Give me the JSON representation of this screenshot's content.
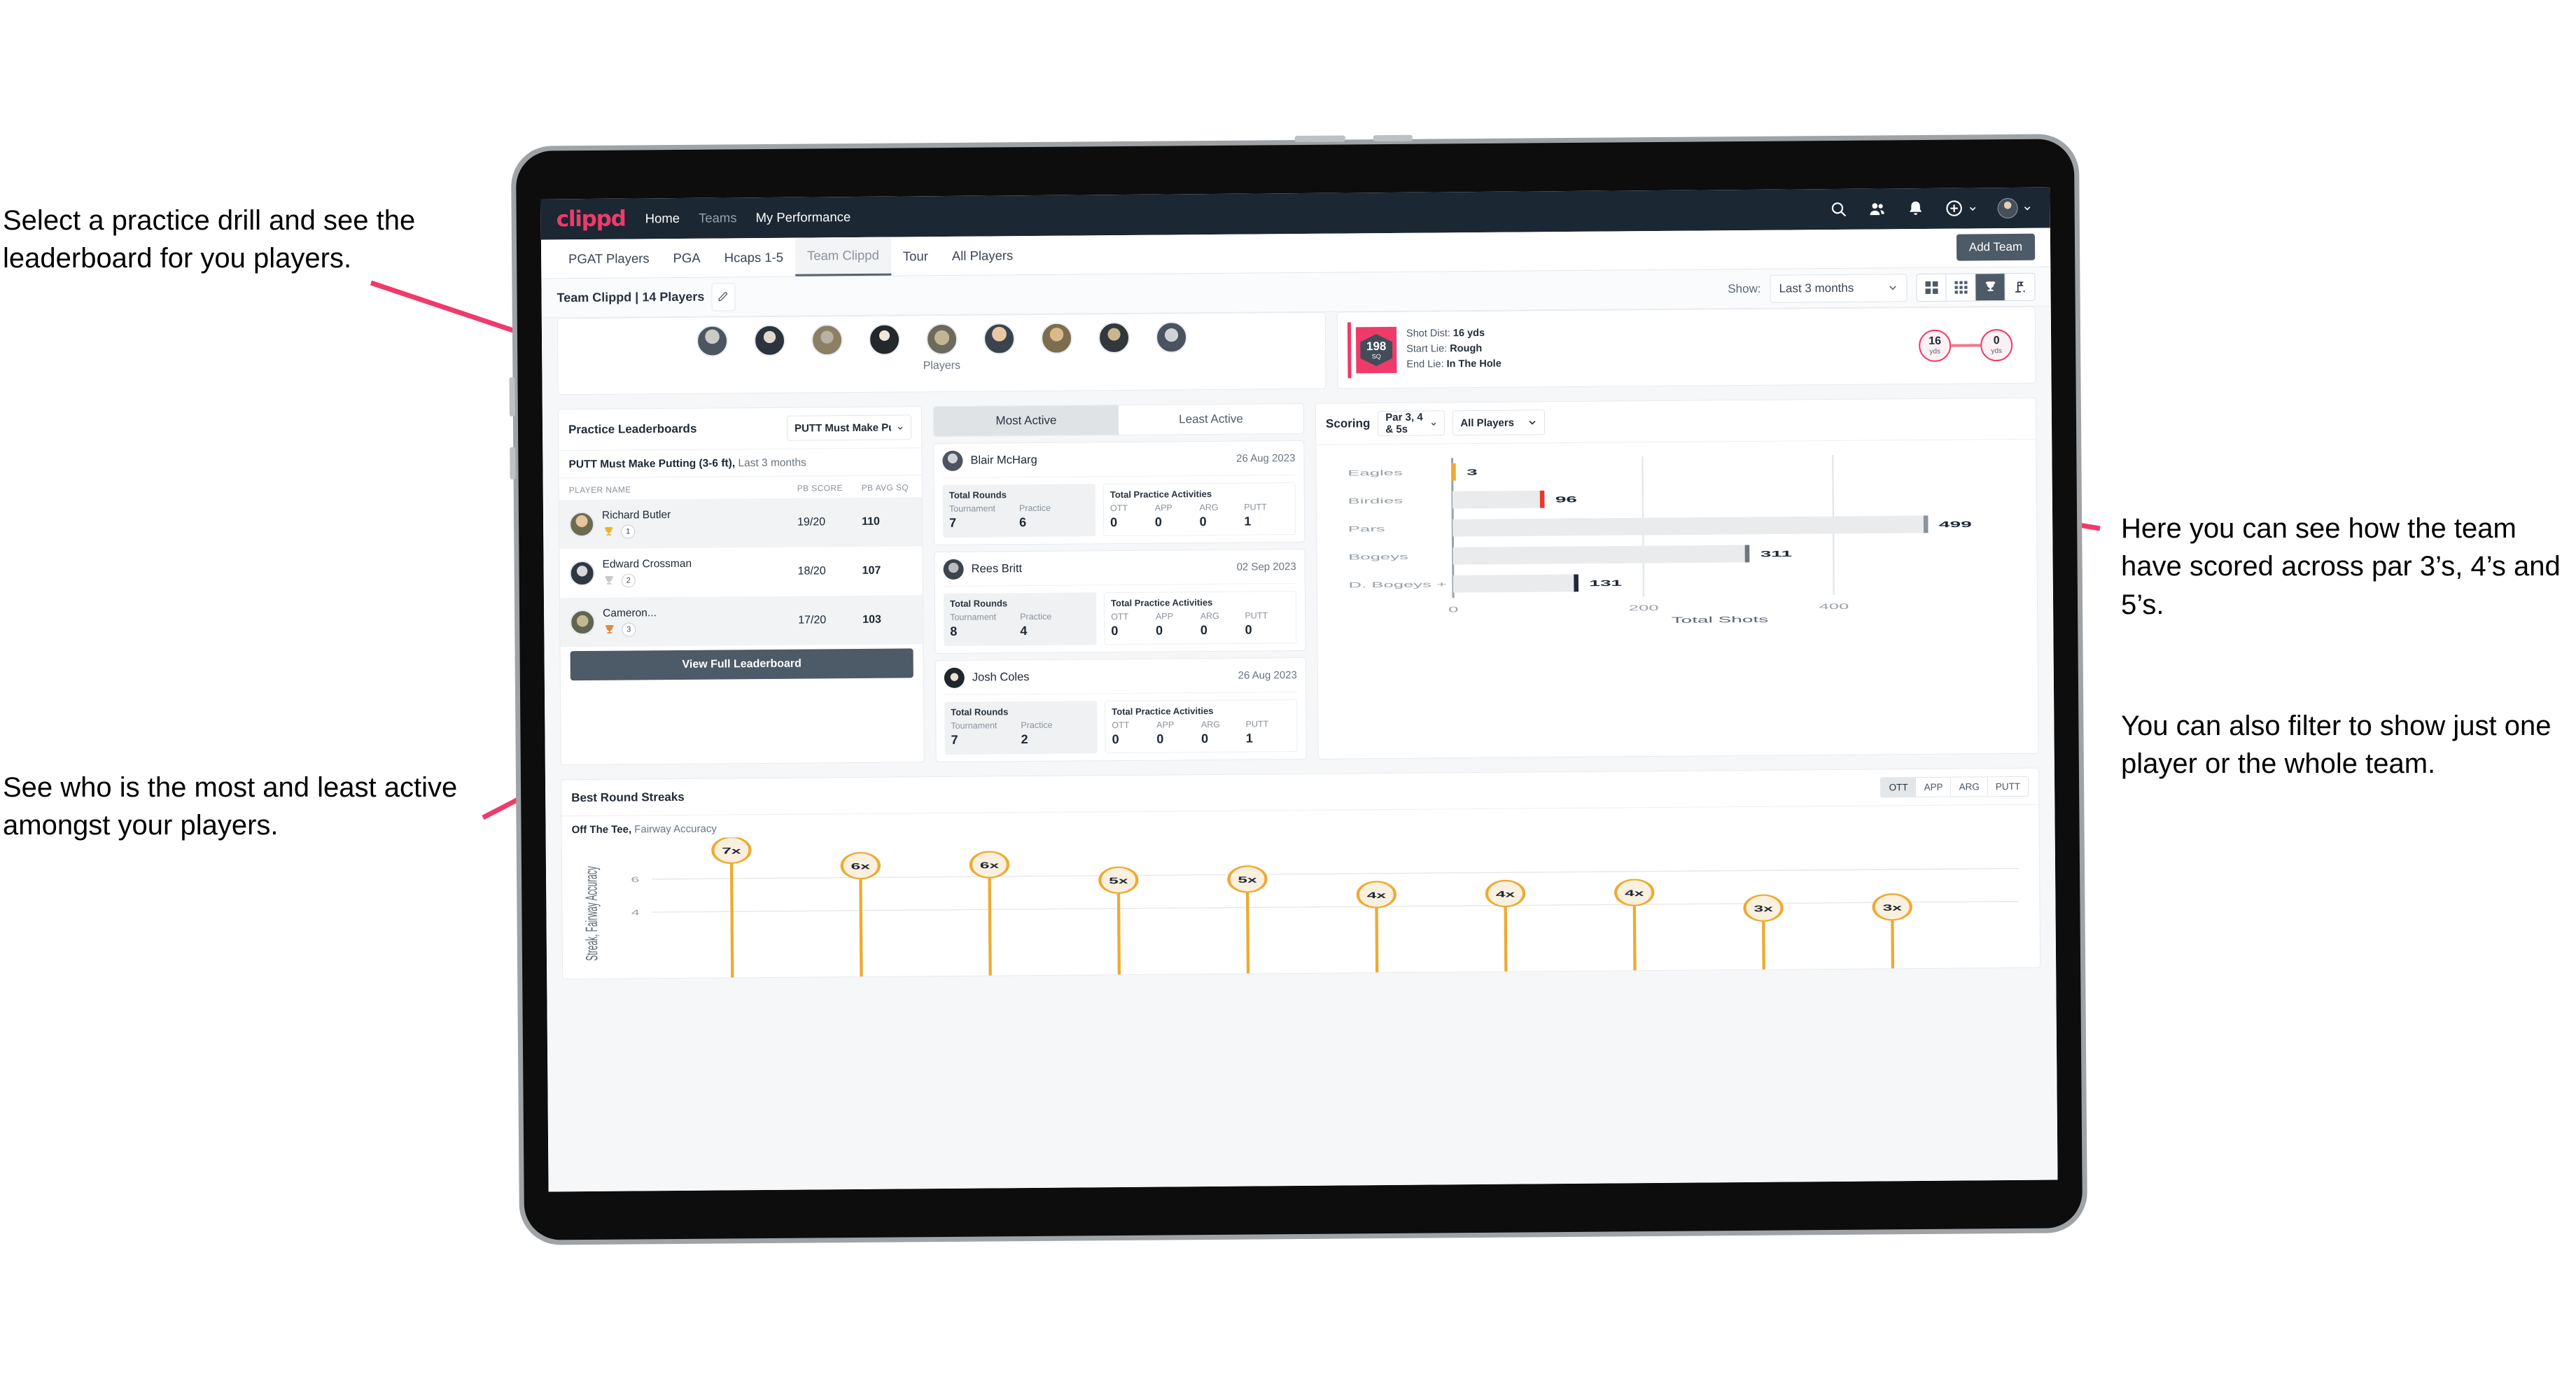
{
  "annotations": {
    "top_left": "Select a practice drill and see the leaderboard for you players.",
    "bottom_left": "See who is the most and least active amongst your players.",
    "right_1": "Here you can see how the team have scored across par 3’s, 4’s and 5’s.",
    "right_2": "You can also filter to show just one player or the whole team."
  },
  "colors": {
    "header_navy": "#1b2733",
    "brand_pink": "#ef3a6a",
    "slate_button": "#4d5a68",
    "gold": "#edab33",
    "page_bg": "#f6f7f9"
  },
  "header": {
    "logo": "clippd",
    "nav": [
      {
        "label": "Home",
        "active": true
      },
      {
        "label": "Teams",
        "active": false
      },
      {
        "label": "My Performance",
        "active": true
      }
    ],
    "icons": [
      "search-icon",
      "people-icon",
      "bell-icon",
      "plus-circle-icon",
      "avatar"
    ]
  },
  "tabs": [
    {
      "label": "PGAT Players",
      "active": false
    },
    {
      "label": "PGA",
      "active": false
    },
    {
      "label": "Hcaps 1-5",
      "active": false
    },
    {
      "label": "Team Clippd",
      "active": true
    },
    {
      "label": "Tour",
      "active": false
    },
    {
      "label": "All Players",
      "active": false
    }
  ],
  "add_team_button": "Add Team",
  "subbar": {
    "team_label": "Team Clippd | 14 Players",
    "edit_icon": "pencil-icon",
    "show_label": "Show:",
    "range_value": "Last 3 months",
    "view_modes": [
      {
        "name": "grid-large-icon",
        "active": false
      },
      {
        "name": "grid-small-icon",
        "active": false
      },
      {
        "name": "trophy-icon",
        "active": true
      },
      {
        "name": "golf-flag-icon",
        "active": false
      }
    ]
  },
  "players_strip": {
    "label": "Players",
    "avatar_count": 9
  },
  "shot_card": {
    "sq_value": "198",
    "sq_unit": "SQ",
    "lines": [
      {
        "key": "Shot Dist:",
        "value": "16 yds"
      },
      {
        "key": "Start Lie:",
        "value": "Rough"
      },
      {
        "key": "End Lie:",
        "value": "In The Hole"
      }
    ],
    "start_dist": {
      "value": "16",
      "unit": "yds"
    },
    "end_dist": {
      "value": "0",
      "unit": "yds"
    }
  },
  "leaderboard": {
    "title": "Practice Leaderboards",
    "drill_selected": "PUTT Must Make Putting ...",
    "subtitle_bold": "PUTT Must Make Putting (3-6 ft),",
    "subtitle_light": "Last 3 months",
    "columns": [
      "PLAYER NAME",
      "PB SCORE",
      "PB AVG SQ"
    ],
    "rows": [
      {
        "name": "Richard Butler",
        "rank": "1",
        "medal": "gold",
        "pb_score": "19/20",
        "pb_avg_sq": "110"
      },
      {
        "name": "Edward Crossman",
        "rank": "2",
        "medal": "silver",
        "pb_score": "18/20",
        "pb_avg_sq": "107"
      },
      {
        "name": "Cameron...",
        "rank": "3",
        "medal": "bronze",
        "pb_score": "17/20",
        "pb_avg_sq": "103"
      }
    ],
    "view_all_button": "View Full Leaderboard"
  },
  "activity": {
    "tabs": [
      {
        "label": "Most Active",
        "active": true
      },
      {
        "label": "Least Active",
        "active": false
      }
    ],
    "rounds_title": "Total Rounds",
    "rounds_keys": [
      "Tournament",
      "Practice"
    ],
    "acts_title": "Total Practice Activities",
    "acts_keys": [
      "OTT",
      "APP",
      "ARG",
      "PUTT"
    ],
    "cards": [
      {
        "name": "Blair McHarg",
        "date": "26 Aug 2023",
        "rounds": [
          "7",
          "6"
        ],
        "acts": [
          "0",
          "0",
          "0",
          "1"
        ]
      },
      {
        "name": "Rees Britt",
        "date": "02 Sep 2023",
        "rounds": [
          "8",
          "4"
        ],
        "acts": [
          "0",
          "0",
          "0",
          "0"
        ]
      },
      {
        "name": "Josh Coles",
        "date": "26 Aug 2023",
        "rounds": [
          "7",
          "2"
        ],
        "acts": [
          "0",
          "0",
          "0",
          "1"
        ]
      }
    ]
  },
  "scoring": {
    "title": "Scoring",
    "par_filter": "Par 3, 4 & 5s",
    "player_filter": "All Players"
  },
  "streaks": {
    "title": "Best Round Streaks",
    "segments": [
      {
        "label": "OTT",
        "active": true
      },
      {
        "label": "APP",
        "active": false
      },
      {
        "label": "ARG",
        "active": false
      },
      {
        "label": "PUTT",
        "active": false
      }
    ],
    "sub_bold": "Off The Tee,",
    "sub_light": "Fairway Accuracy"
  },
  "chart_data": [
    {
      "type": "bar",
      "orientation": "horizontal",
      "title": "Scoring",
      "xlabel": "Total Shots",
      "ylabel": "",
      "categories": [
        "Eagles",
        "Birdies",
        "Pars",
        "Bogeys",
        "D. Bogeys +"
      ],
      "values": [
        3,
        96,
        499,
        311,
        131
      ],
      "labels": [
        "3",
        "96",
        "499",
        "311",
        "131"
      ],
      "cap_colors": [
        "#edab33",
        "#e8392e",
        "#8b949c",
        "#6d7780",
        "#1f2833"
      ],
      "bar_color": "#e9ebed",
      "xlim": [
        0,
        560
      ],
      "xticks": [
        0,
        200,
        400
      ],
      "xtick_labels": [
        "0",
        "200",
        "400"
      ],
      "grid": true,
      "legend": "none"
    },
    {
      "type": "scatter",
      "variant": "lollipop",
      "title": "Best Round Streaks",
      "subtitle": "Off The Tee, Fairway Accuracy",
      "ylabel": "Streak, Fairway Accuracy",
      "xlabel": "",
      "yticks": [
        4,
        6
      ],
      "ytick_labels": [
        "4",
        "6"
      ],
      "ylim": [
        0,
        7.9
      ],
      "grid": true,
      "marker_color": "#faf0df",
      "marker_edge": "#edab33",
      "stem_color": "#edab33",
      "points": [
        {
          "x": 0,
          "y": 7,
          "label": "7x"
        },
        {
          "x": 1,
          "y": 6,
          "label": "6x"
        },
        {
          "x": 2,
          "y": 6,
          "label": "6x"
        },
        {
          "x": 3,
          "y": 5,
          "label": "5x"
        },
        {
          "x": 4,
          "y": 5,
          "label": "5x"
        },
        {
          "x": 5,
          "y": 4,
          "label": "4x"
        },
        {
          "x": 6,
          "y": 4,
          "label": "4x"
        },
        {
          "x": 7,
          "y": 4,
          "label": "4x"
        },
        {
          "x": 8,
          "y": 3,
          "label": "3x"
        },
        {
          "x": 9,
          "y": 3,
          "label": "3x"
        }
      ]
    }
  ]
}
